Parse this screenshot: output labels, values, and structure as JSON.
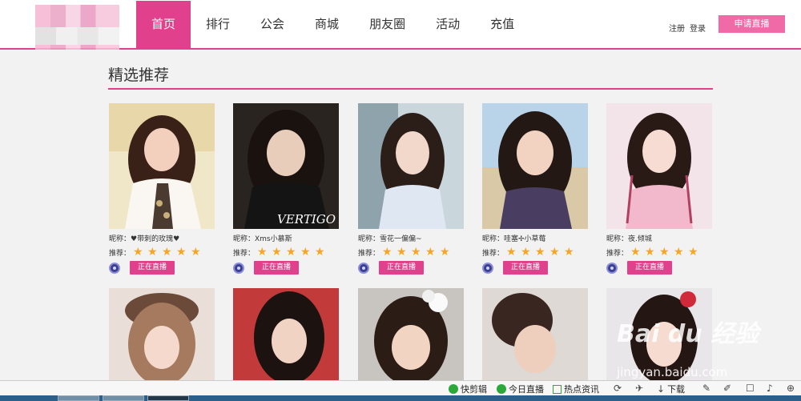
{
  "header": {
    "nav": [
      "首页",
      "排行",
      "公会",
      "商城",
      "朋友圈",
      "活动",
      "充值"
    ],
    "register": "注册",
    "login": "登录",
    "apply": "申请直播"
  },
  "section": {
    "title": "精选推荐"
  },
  "cards": [
    {
      "nick": "昵称：♥带刺的玫瑰♥",
      "rec": "推荐：",
      "stars": 5,
      "live": "正在直播"
    },
    {
      "nick": "昵称：Xms小慕斯",
      "rec": "推荐：",
      "stars": 5,
      "live": "正在直播"
    },
    {
      "nick": "昵称：雪花一偏偏~",
      "rec": "推荐：",
      "stars": 5,
      "live": "正在直播"
    },
    {
      "nick": "昵称：哇塞✢小草莓",
      "rec": "推荐：",
      "stars": 5,
      "live": "正在直播"
    },
    {
      "nick": "昵称：夜.倾城",
      "rec": "推荐：",
      "stars": 5,
      "live": "正在直播"
    }
  ],
  "photo_text": "VERTIGO",
  "statusbar": {
    "items": [
      "快剪辑",
      "今日直播",
      "热点资讯",
      "下载"
    ]
  },
  "watermark": {
    "main": "Bai du 经验",
    "sub": "jingyan.baidu.com"
  },
  "colors": {
    "accent": "#e0408c",
    "star": "#f5a623"
  }
}
